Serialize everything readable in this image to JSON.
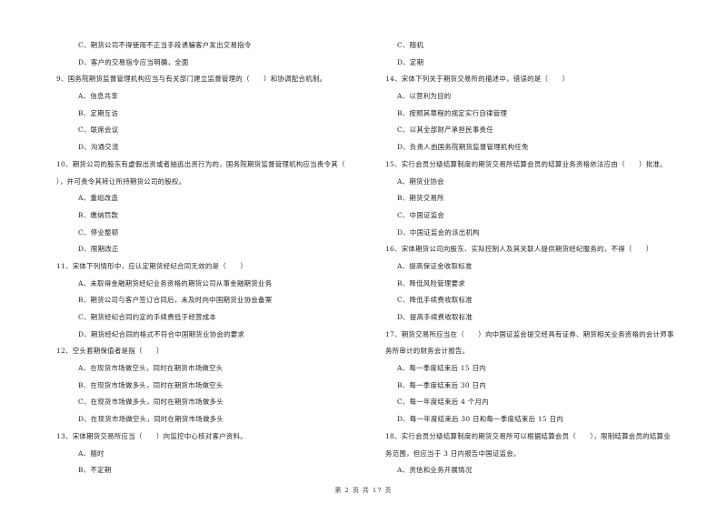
{
  "left_column": [
    {
      "type": "opt",
      "text": "C、期货公司不得使用不正当手段诱骗客户发出交易指令"
    },
    {
      "type": "opt",
      "text": "D、客户的交易指令应当明确，全面"
    },
    {
      "type": "q",
      "text": "9、国务院期货监督管理机构应当与有关部门建立监督管理的（　　）和协调配合机制。"
    },
    {
      "type": "opt",
      "text": "A、信息共享"
    },
    {
      "type": "opt",
      "text": "B、定期互访"
    },
    {
      "type": "opt",
      "text": "C、联席会议"
    },
    {
      "type": "opt",
      "text": "D、沟通交流"
    },
    {
      "type": "q",
      "text": "10、期货公司的股东有虚假出资或者抽逃出资行为的，国务院期货监督管理机构应当责令其（"
    },
    {
      "type": "cont",
      "text": "），并可责令其转让所持期货公司的股权。"
    },
    {
      "type": "opt",
      "text": "A、重组改造"
    },
    {
      "type": "opt",
      "text": "B、缴纳罚款"
    },
    {
      "type": "opt",
      "text": "C、停业整顿"
    },
    {
      "type": "opt",
      "text": "D、限期改正"
    },
    {
      "type": "q",
      "text": "11、宋体下列情形中，应认定期货经纪合同无效的是（　　）"
    },
    {
      "type": "opt",
      "text": "A、未取得金融期货经纪业务资格的期货公司从事金融期货业务"
    },
    {
      "type": "opt",
      "text": "B、期货公司与客户签订合同后，未及时向中国期货业协会备案"
    },
    {
      "type": "opt",
      "text": "C、期货经纪合同约定的手续费低于经营成本"
    },
    {
      "type": "opt",
      "text": "D、期货经纪合同的格式不符合中国期货业协会的要求"
    },
    {
      "type": "q",
      "text": "12、空头套期保值者是指（　　）"
    },
    {
      "type": "opt",
      "text": "A、在现货市场做空头，同时在期货市场做空头"
    },
    {
      "type": "opt",
      "text": "B、在现货市场做多头，同时在期货市场做空头"
    },
    {
      "type": "opt",
      "text": "C、在现货市场做多头，同时在期货市场做多头"
    },
    {
      "type": "opt",
      "text": "D、在现货市场做空头，同时在期货市场做多头"
    },
    {
      "type": "q",
      "text": "13、宋体期货交易所应当（　　）向监控中心核对客户资料。"
    },
    {
      "type": "opt",
      "text": "A、随时"
    },
    {
      "type": "opt",
      "text": "B、不定期"
    }
  ],
  "right_column": [
    {
      "type": "opt",
      "text": "C、随机"
    },
    {
      "type": "opt",
      "text": "D、定期"
    },
    {
      "type": "q",
      "text": "14、宋体下列关于期货交易所的描述中，错误的是（　　）"
    },
    {
      "type": "opt",
      "text": "A、以营利为目的"
    },
    {
      "type": "opt",
      "text": "B、按照其章程的规定实行自律管理"
    },
    {
      "type": "opt",
      "text": "C、以其全部财产承担民事责任"
    },
    {
      "type": "opt",
      "text": "D、负责人由国务院期货监督管理机构任免"
    },
    {
      "type": "q",
      "text": "15、实行会员分级结算制度的期货交易所结算会员的结算业务资格依法应由（　　）批准。"
    },
    {
      "type": "opt",
      "text": "A、期货业协会"
    },
    {
      "type": "opt",
      "text": "B、期货交易所"
    },
    {
      "type": "opt",
      "text": "C、中国证监会"
    },
    {
      "type": "opt",
      "text": "D、中国证监会的派出机构"
    },
    {
      "type": "q",
      "text": "16、宋体期货公司向股东、实际控制人及其关联人提供期货经纪服务的，不得（　　）"
    },
    {
      "type": "opt",
      "text": "A、提高保证金收取标准"
    },
    {
      "type": "opt",
      "text": "B、降低风险管理要求"
    },
    {
      "type": "opt",
      "text": "C、降低手续费收取标准"
    },
    {
      "type": "opt",
      "text": "D、提高手续费收取标准"
    },
    {
      "type": "q",
      "text": "17、期货交易所应当在（　　）向中国证监会提交经具有证券、期货相关业务资格的会计师事"
    },
    {
      "type": "cont",
      "text": "务所审计的财务会计报告。"
    },
    {
      "type": "opt",
      "text": "A、每一季度结束后 15 日内"
    },
    {
      "type": "opt",
      "text": "B、每一季度结束后 30 日内"
    },
    {
      "type": "opt",
      "text": "C、每一年度结束后 4 个月内"
    },
    {
      "type": "opt",
      "text": "D、每一年度结束后 30 日和每一季度结束后 15 日内"
    },
    {
      "type": "q",
      "text": "18、实行会员分级结算制度的期货交易所可以根据结算会员（　　），限制结算会员的结算业"
    },
    {
      "type": "cont",
      "text": "务范围，但应当于 3 日内报告中国证监会。"
    },
    {
      "type": "opt",
      "text": "A、资信和业务开展情况"
    }
  ],
  "footer": {
    "page_label": "第 2 页 共 17 页"
  }
}
